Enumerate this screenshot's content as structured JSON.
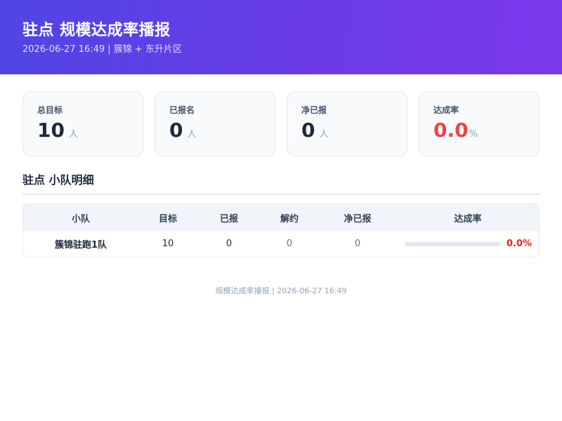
{
  "header": {
    "title": "驻点 规模达成率播报",
    "subtitle": "2026-06-27 16:49 | 簇锦 + 东升片区"
  },
  "stats": [
    {
      "label": "总目标",
      "value": "10",
      "unit": "人"
    },
    {
      "label": "已报名",
      "value": "0",
      "unit": "人"
    },
    {
      "label": "净已报",
      "value": "0",
      "unit": "人"
    },
    {
      "label": "达成率",
      "value": "0.0",
      "unit": "%",
      "color": "#ef4444"
    }
  ],
  "section": {
    "title": "驻点 小队明细"
  },
  "table": {
    "headers": [
      "小队",
      "目标",
      "已报",
      "解约",
      "净已报",
      "达成率"
    ],
    "rows": [
      {
        "team": "簇锦驻跑1队",
        "target": "10",
        "signed": "0",
        "cancelled": "0",
        "net": "0",
        "rate": "0.0%",
        "rate_fraction": 0.0
      }
    ]
  },
  "footer": {
    "text": "规模达成率播报 | 2026-06-27 16:49"
  }
}
